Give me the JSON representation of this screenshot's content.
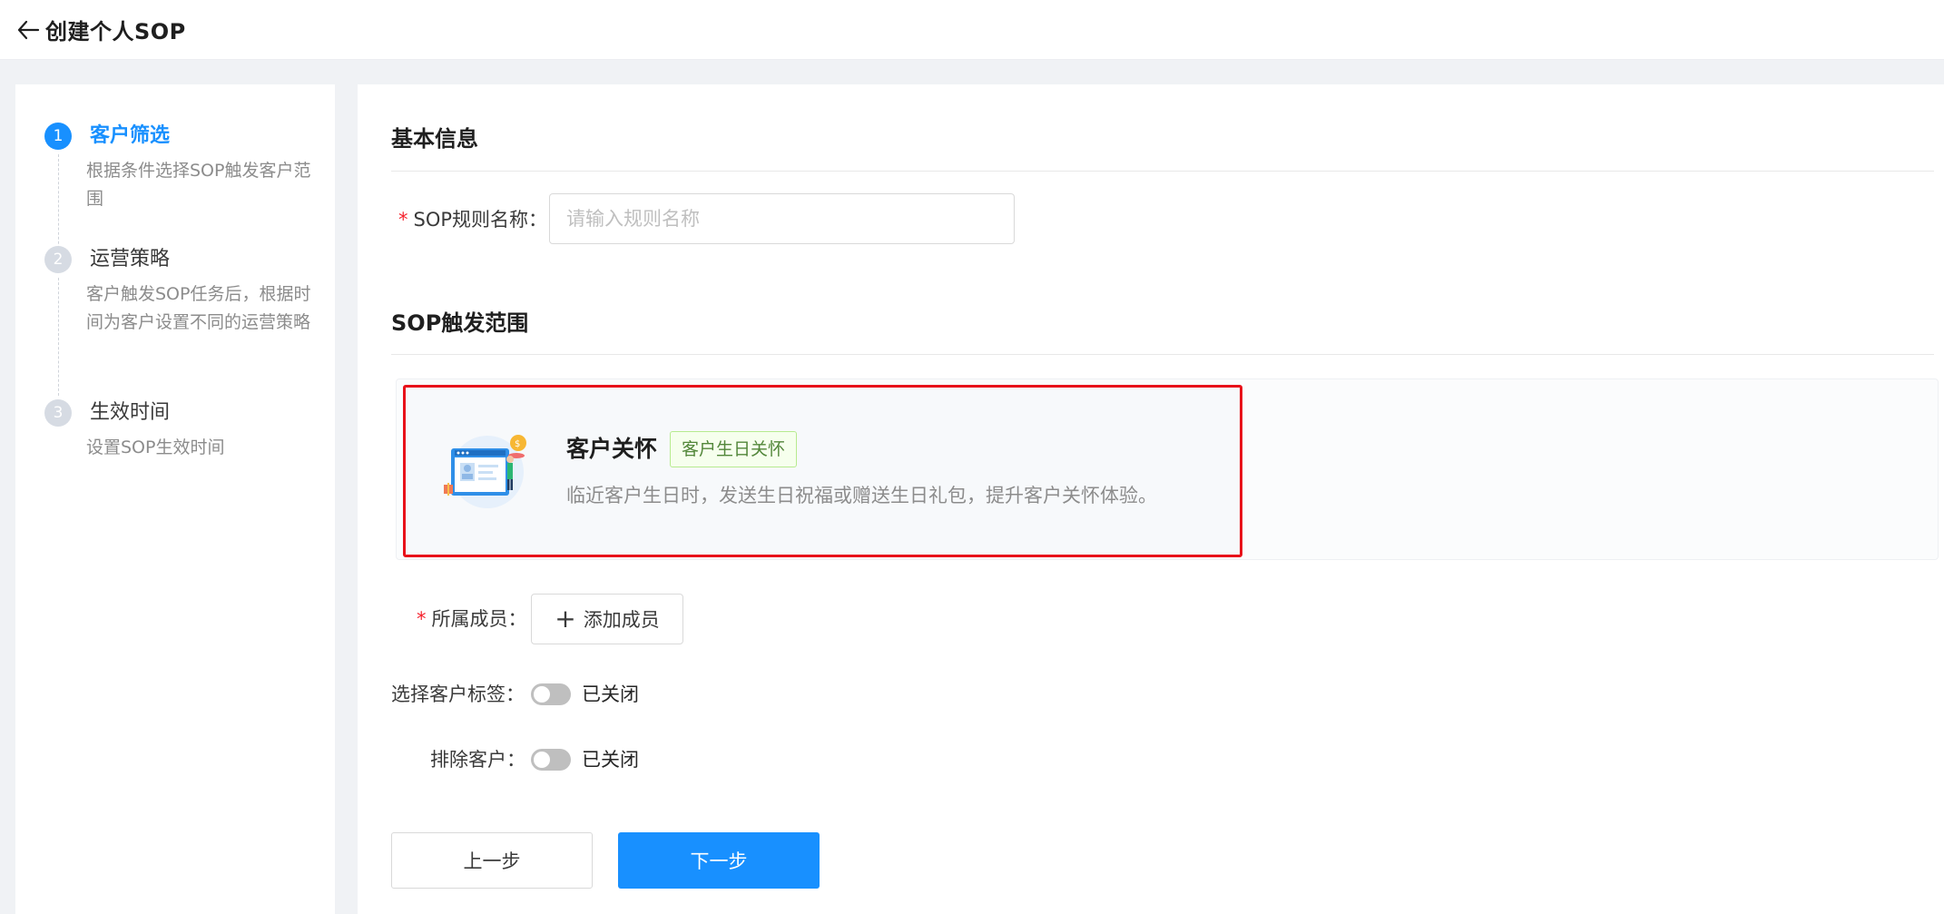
{
  "header": {
    "title": "创建个人SOP",
    "back_icon": "arrow-left-icon"
  },
  "steps": [
    {
      "number": "1",
      "title": "客户筛选",
      "desc": "根据条件选择SOP触发客户范围",
      "state": "active"
    },
    {
      "number": "2",
      "title": "运营策略",
      "desc": "客户触发SOP任务后，根据时间为客户设置不同的运营策略",
      "state": "inactive"
    },
    {
      "number": "3",
      "title": "生效时间",
      "desc": "设置SOP生效时间",
      "state": "inactive"
    }
  ],
  "basic_info": {
    "section_title": "基本信息",
    "name_label": "SOP规则名称：",
    "name_required": "*",
    "name_value": "",
    "name_placeholder": "请输入规则名称"
  },
  "trigger_scope": {
    "section_title": "SOP触发范围",
    "scene": {
      "title": "客户关怀",
      "badge": "客户生日关怀",
      "desc": "临近客户生日时，发送生日祝福或赠送生日礼包，提升客户关怀体验。",
      "illustration": "customer-care-illustration-icon",
      "highlight_color": "#e8121a"
    },
    "member_label": "所属成员：",
    "member_required": "*",
    "add_member_label": "添加成员",
    "tag_label": "选择客户标签：",
    "tag_switch_text": "已关闭",
    "exclude_label": "排除客户：",
    "exclude_switch_text": "已关闭"
  },
  "footer": {
    "prev_label": "上一步",
    "next_label": "下一步"
  },
  "colors": {
    "primary": "#1890ff",
    "required": "#f5222d",
    "badge_border": "#b7eb8f"
  }
}
